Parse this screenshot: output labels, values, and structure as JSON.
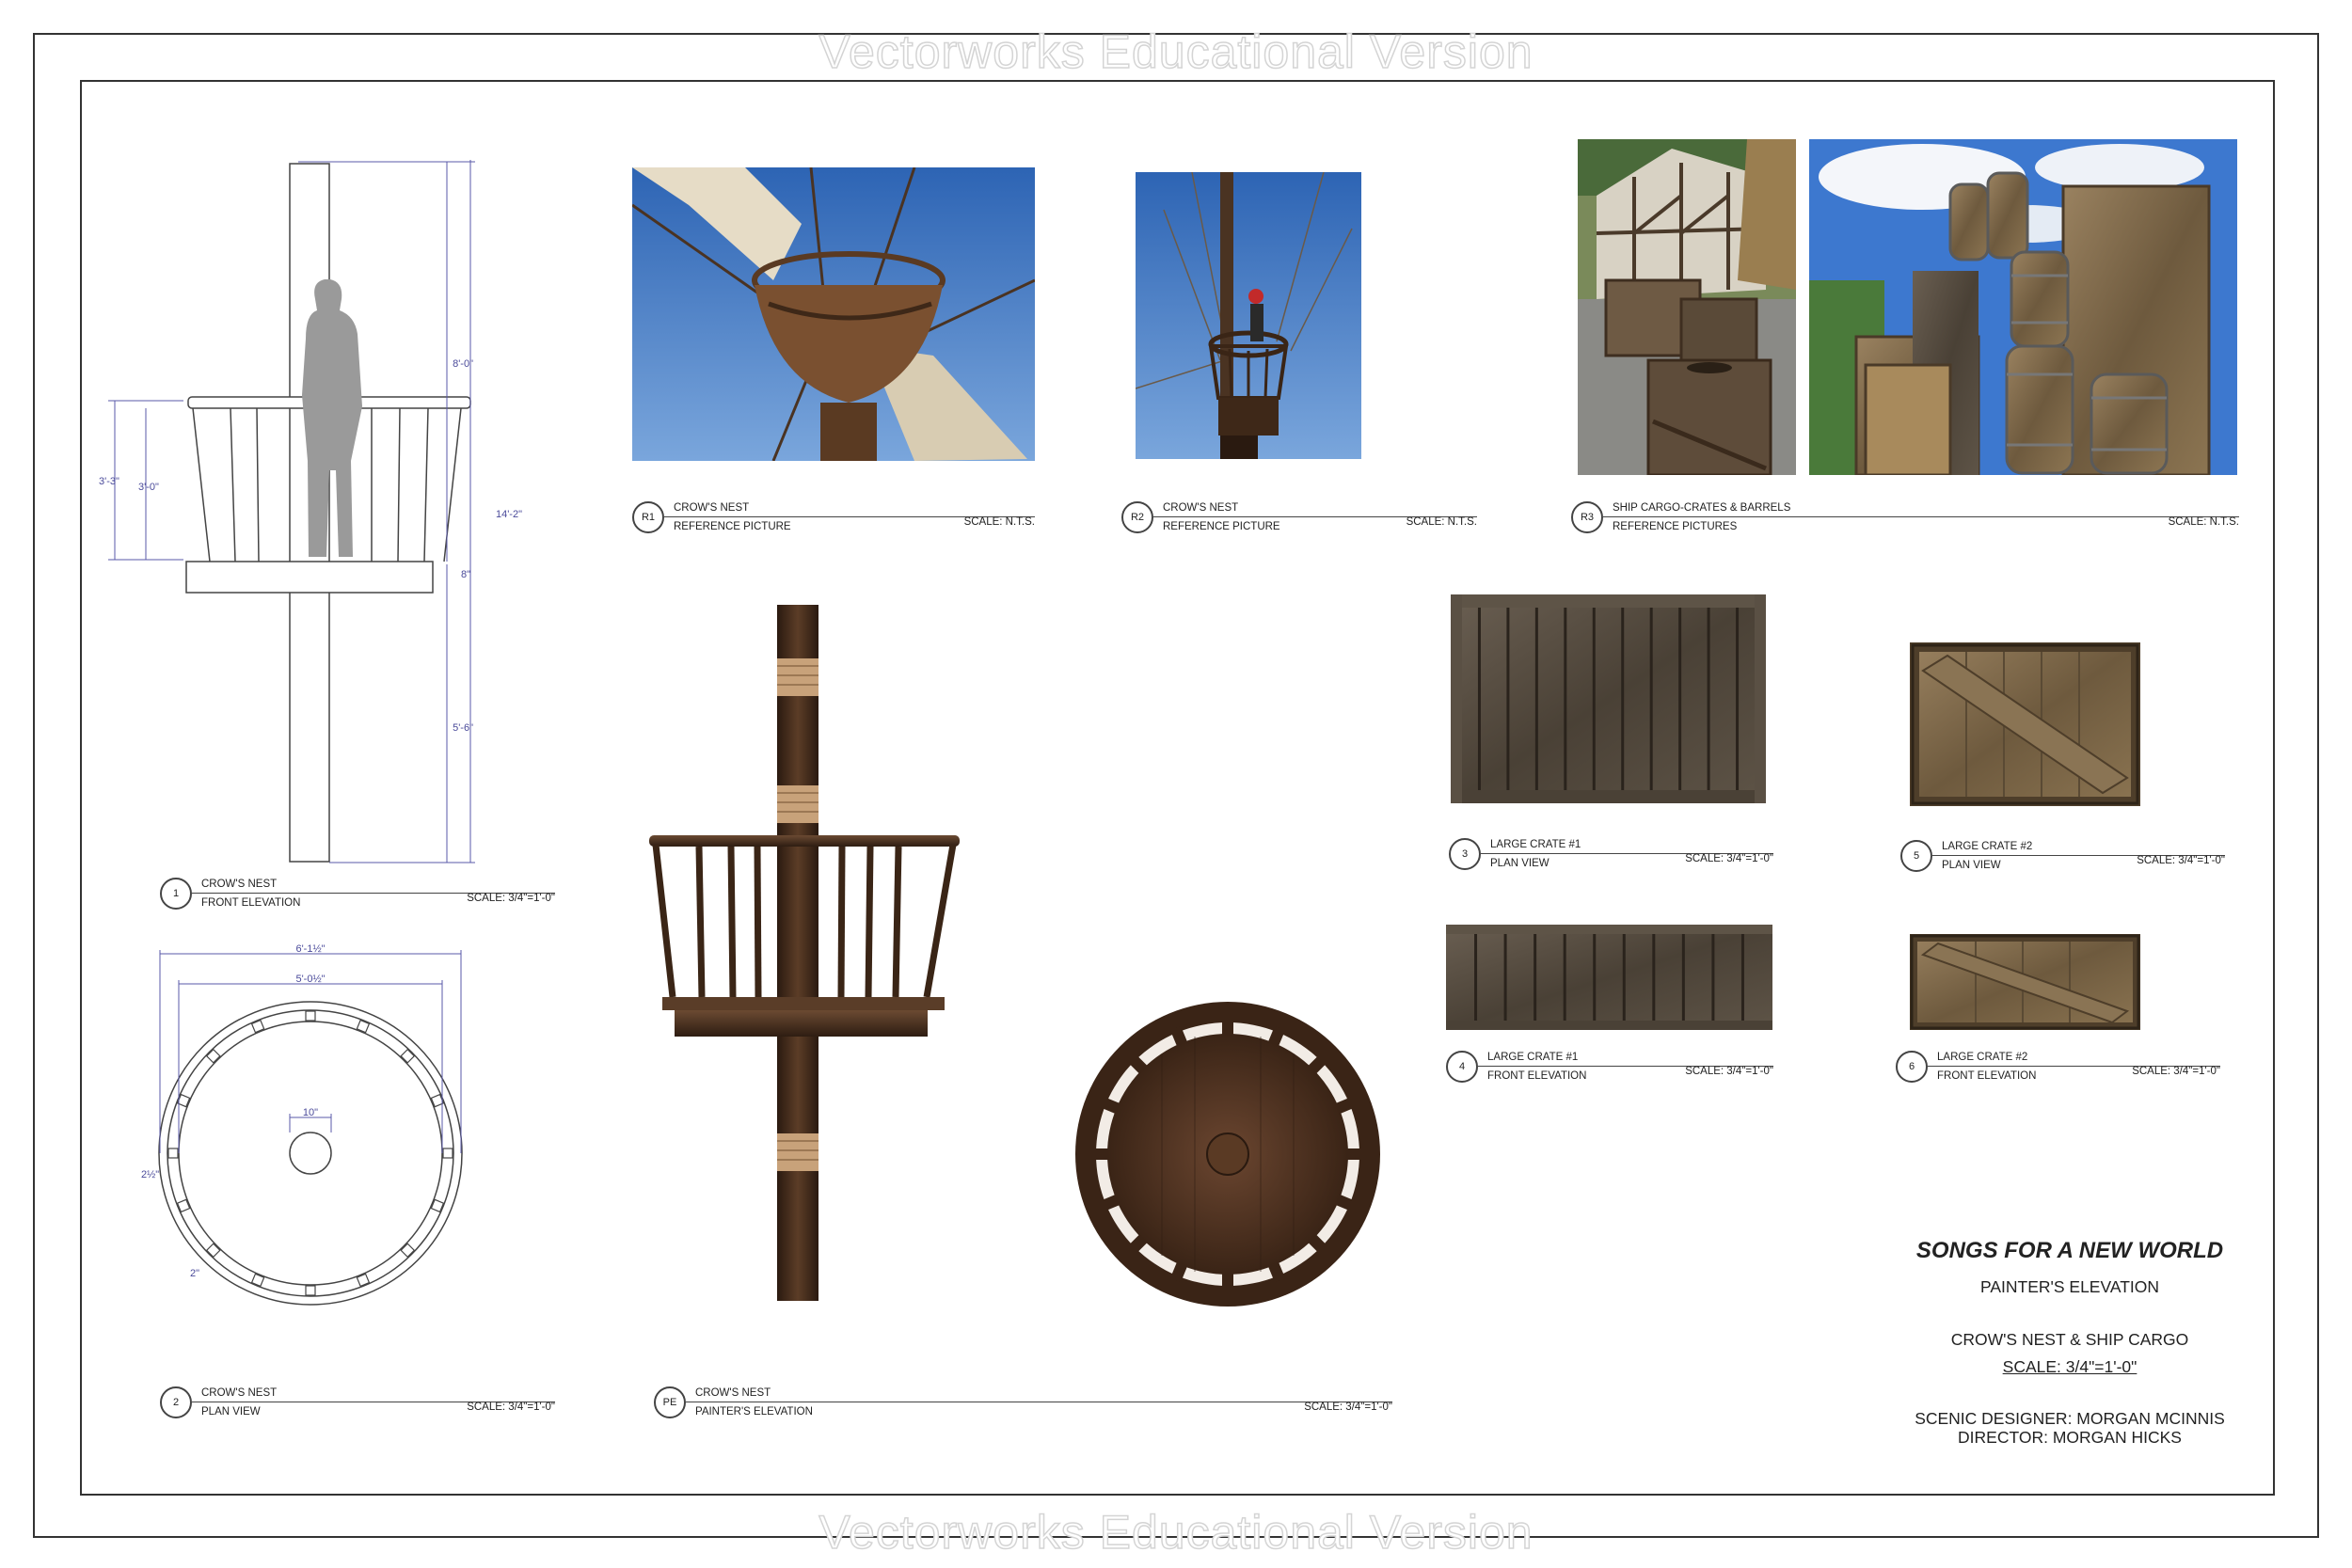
{
  "watermark": "Vectorworks Educational Version",
  "drawings": {
    "d1": {
      "num": "1",
      "title": "CROW'S NEST",
      "subtitle": "FRONT ELEVATION",
      "scale": "SCALE: 3/4\"=1'-0\""
    },
    "d2": {
      "num": "2",
      "title": "CROW'S NEST",
      "subtitle": "PLAN VIEW",
      "scale": "SCALE: 3/4\"=1'-0\""
    },
    "pe": {
      "num": "PE",
      "title": "CROW'S NEST",
      "subtitle": "PAINTER'S ELEVATION",
      "scale": "SCALE: 3/4\"=1'-0\""
    },
    "r1": {
      "num": "R1",
      "title": "CROW'S NEST",
      "subtitle": "REFERENCE PICTURE",
      "scale": "SCALE: N.T.S."
    },
    "r2": {
      "num": "R2",
      "title": "CROW'S NEST",
      "subtitle": "REFERENCE PICTURE",
      "scale": "SCALE: N.T.S."
    },
    "r3": {
      "num": "R3",
      "title": "SHIP CARGO-CRATES & BARRELS",
      "subtitle": "REFERENCE PICTURES",
      "scale": "SCALE: N.T.S."
    },
    "d3": {
      "num": "3",
      "title": "LARGE CRATE #1",
      "subtitle": "PLAN VIEW",
      "scale": "SCALE: 3/4\"=1'-0\""
    },
    "d4": {
      "num": "4",
      "title": "LARGE CRATE #1",
      "subtitle": "FRONT ELEVATION",
      "scale": "SCALE: 3/4\"=1'-0\""
    },
    "d5": {
      "num": "5",
      "title": "LARGE CRATE #2",
      "subtitle": "PLAN VIEW",
      "scale": "SCALE: 3/4\"=1'-0\""
    },
    "d6": {
      "num": "6",
      "title": "LARGE CRATE #2",
      "subtitle": "FRONT ELEVATION",
      "scale": "SCALE: 3/4\"=1'-0\""
    }
  },
  "dimensions": {
    "overall_height": "14'-2\"",
    "upper_height": "8'-0\"",
    "rail_height_outer": "3'-3\"",
    "rail_height_inner": "3'-0\"",
    "floor_thickness": "8\"",
    "lower_height": "5'-6\"",
    "outer_diameter": "6'-1½\"",
    "inner_diameter": "5'-0½\"",
    "mast_hole": "10\"",
    "rail_width": "2½\"",
    "post_size": "2\""
  },
  "title_block": {
    "show": "SONGS FOR A NEW WORLD",
    "sheet_type": "PAINTER'S ELEVATION",
    "sheet_name": "CROW'S NEST & SHIP CARGO",
    "scale": "SCALE: 3/4\"=1'-0\"",
    "designer": "SCENIC DESIGNER: MORGAN MCINNIS",
    "director": "DIRECTOR: MORGAN HICKS"
  },
  "colors": {
    "dimension_ink": "#4a4a9a",
    "wood_dark": "#3e2a1c",
    "wood_mid": "#5a3d28",
    "sky": "#4a7fc4"
  }
}
